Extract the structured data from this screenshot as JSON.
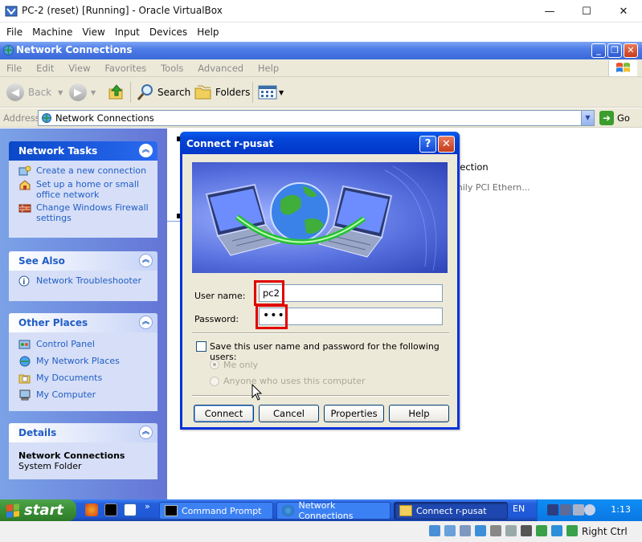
{
  "host": {
    "title": "PC-2 (reset) [Running] - Oracle VirtualBox",
    "controls": [
      "—",
      "☐",
      "✕"
    ],
    "menu": [
      "File",
      "Machine",
      "View",
      "Input",
      "Devices",
      "Help"
    ],
    "status_host_key": "Right Ctrl"
  },
  "explorer": {
    "title": "Network Connections",
    "menu": [
      "File",
      "Edit",
      "View",
      "Favorites",
      "Tools",
      "Advanced",
      "Help"
    ],
    "toolbar": {
      "back": "Back",
      "search": "Search",
      "folders": "Folders"
    },
    "address": {
      "label": "Address",
      "value": "Network Connections",
      "go": "Go"
    },
    "content_fragments": [
      "nection",
      "mily PCI Ethern..."
    ]
  },
  "taskpane": {
    "network_tasks": {
      "title": "Network Tasks",
      "items": [
        "Create a new connection",
        "Set up a home or small office network",
        "Change Windows Firewall settings"
      ]
    },
    "see_also": {
      "title": "See Also",
      "items": [
        "Network Troubleshooter"
      ]
    },
    "other_places": {
      "title": "Other Places",
      "items": [
        "Control Panel",
        "My Network Places",
        "My Documents",
        "My Computer"
      ]
    },
    "details": {
      "title": "Details",
      "name": "Network Connections",
      "type": "System Folder"
    }
  },
  "dialog": {
    "title": "Connect r-pusat",
    "help_btn": "?",
    "close_btn": "✕",
    "username_label": "User name:",
    "username_value": "pc2",
    "password_label": "Password:",
    "password_value": "•••",
    "save_label": "Save this user name and password for the following users:",
    "option_me": "Me only",
    "option_anyone": "Anyone who uses this computer",
    "buttons": {
      "connect": "Connect",
      "cancel": "Cancel",
      "properties": "Properties",
      "help": "Help"
    }
  },
  "taskbar": {
    "start": "start",
    "buttons": [
      "Command Prompt",
      "Network Connections",
      "Connect r-pusat"
    ],
    "lang": "EN",
    "clock": "1:13",
    "chevron": "»"
  },
  "colors": {
    "xp_blue": "#0831d9",
    "taskpane_link": "#215dc6",
    "highlight_red": "#e00000",
    "start_green": "#3a8f35"
  }
}
